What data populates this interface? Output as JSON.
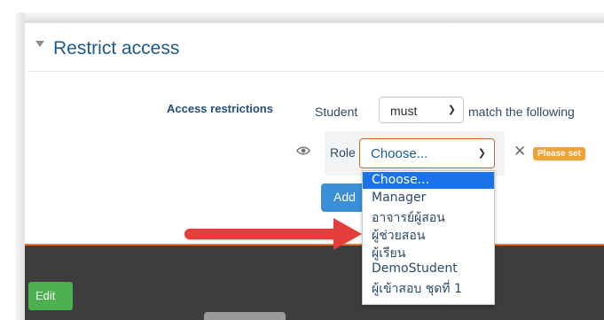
{
  "section": {
    "title": "Restrict access"
  },
  "restrictions": {
    "label": "Access restrictions",
    "prefix": "Student",
    "must_value": "must",
    "suffix": "match the following"
  },
  "condition": {
    "type_label": "Role",
    "selected": "Choose...",
    "badge": "Please set"
  },
  "add_button_label": "Add",
  "dropdown": {
    "options": [
      "Choose...",
      "Manager",
      "อาจารย์ผู้สอน",
      "ผู้ช่วยสอน",
      "ผู้เรียน",
      "DemoStudent",
      "ผู้เข้าสอบ ชุดที่ 1"
    ],
    "highlighted_index": 0
  },
  "footer": {
    "edit_label": "Edit"
  },
  "colors": {
    "accent": "#1a73e8",
    "title": "#1a5a8f",
    "badge": "#f0a234",
    "orange_line": "#e8752a",
    "edit_button": "#4caf50",
    "arrow": "#e53c3c"
  },
  "icons": [
    "caret-down-icon",
    "eye-icon",
    "chevron-down-icon",
    "close-icon",
    "arrow-right-icon"
  ]
}
